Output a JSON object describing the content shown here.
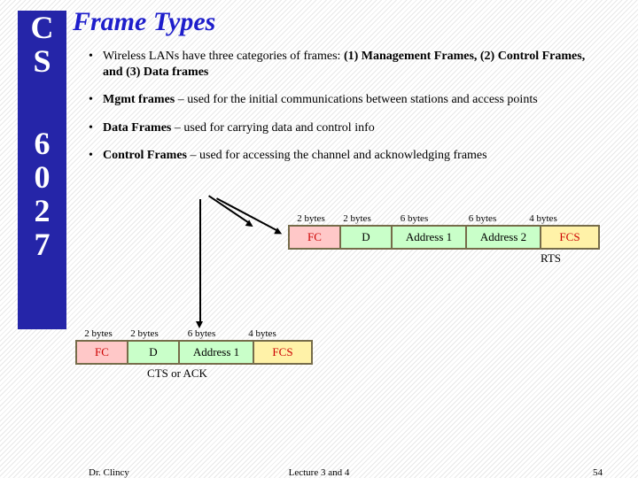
{
  "sidebar": {
    "line1": "C",
    "line2": "S",
    "line3": "6",
    "line4": "0",
    "line5": "2",
    "line6": "7"
  },
  "title": "Frame Types",
  "bullets": {
    "b1_pre": "Wireless LANs have three categories of frames: ",
    "b1_bold": "(1) Management Frames, (2) Control Frames, and (3) Data frames",
    "b2_bold": "Mgmt frames",
    "b2_rest": " – used for the initial communications between stations and access points",
    "b3_bold": "Data Frames",
    "b3_rest": " – used for carrying data and control info",
    "b4_bold": "Control Frames",
    "b4_rest": " – used for accessing the channel and acknowledging frames"
  },
  "rts": {
    "bytes": [
      "2 bytes",
      "2 bytes",
      "6 bytes",
      "6 bytes",
      "4 bytes"
    ],
    "cells": [
      "FC",
      "D",
      "Address 1",
      "Address 2",
      "FCS"
    ],
    "caption": "RTS"
  },
  "cts": {
    "bytes": [
      "2 bytes",
      "2 bytes",
      "6 bytes",
      "4 bytes"
    ],
    "cells": [
      "FC",
      "D",
      "Address 1",
      "FCS"
    ],
    "caption": "CTS or ACK"
  },
  "footer": {
    "left": "Dr. Clincy",
    "center": "Lecture 3 and 4",
    "right": "54"
  }
}
